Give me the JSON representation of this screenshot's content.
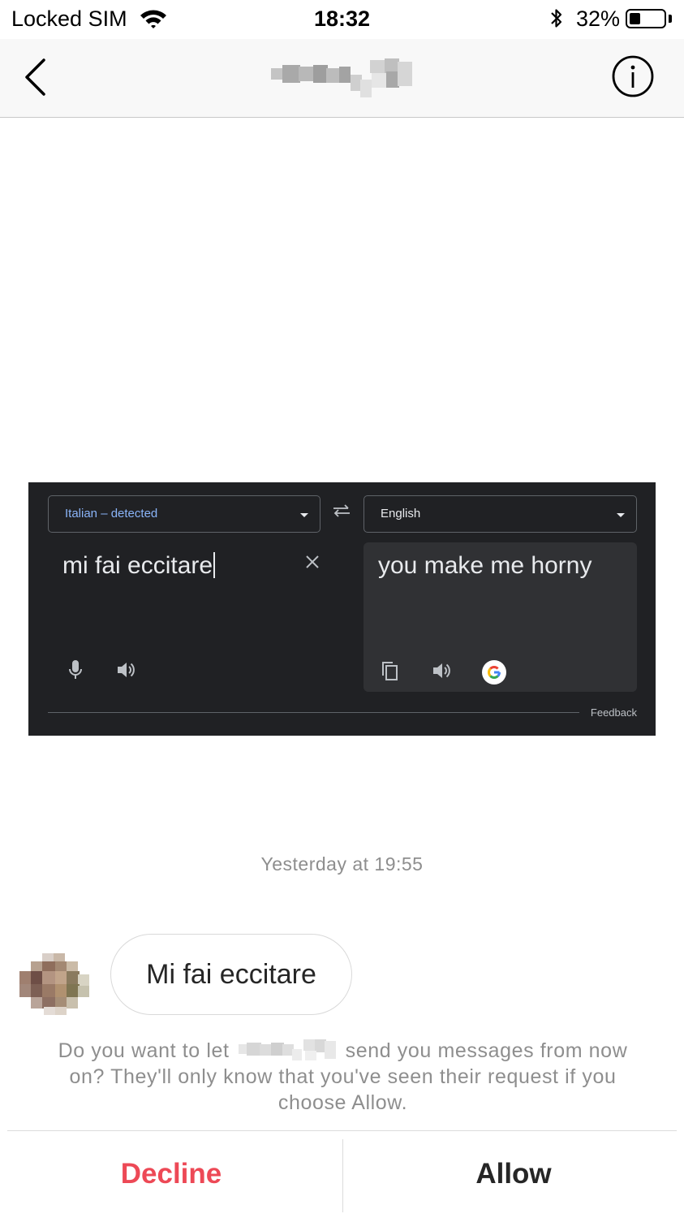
{
  "status_bar": {
    "carrier": "Locked SIM",
    "time": "18:32",
    "battery_percent": "32%",
    "battery_level": 0.32
  },
  "header": {
    "back_icon": "chevron-left-icon",
    "info_icon": "info-circle-icon"
  },
  "shared_image": {
    "source_language": "Italian – detected",
    "target_language": "English",
    "source_text": "mi fai eccitare",
    "translated_text": "you make me horny",
    "feedback_label": "Feedback"
  },
  "conversation": {
    "timestamp": "Yesterday at 19:55",
    "message_text": "Mi fai eccitare"
  },
  "request_prompt": {
    "text_before": "Do you want to let",
    "text_after": "send you messages from now on? They'll only know that you've seen their request if you choose Allow."
  },
  "actions": {
    "decline_label": "Decline",
    "allow_label": "Allow",
    "decline_color": "#ed4956",
    "allow_color": "#262626"
  }
}
